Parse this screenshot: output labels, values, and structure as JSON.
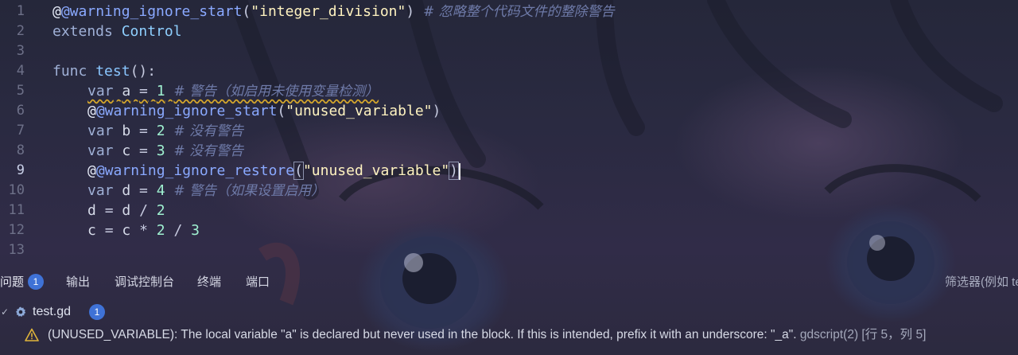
{
  "editor": {
    "active_line": 9,
    "lines": [
      {
        "n": "1",
        "annotation": "@warning_ignore_start",
        "arg": "\"integer_division\"",
        "comment": "# 忽略整个代码文件的整除警告"
      },
      {
        "n": "2",
        "keyword": "extends",
        "class_name": "Control"
      },
      {
        "n": "3"
      },
      {
        "n": "4",
        "keyword": "func",
        "func_name": "test",
        "tail": "():"
      },
      {
        "n": "5",
        "keyword": "var",
        "name": "a",
        "eq": "=",
        "value": "1",
        "comment": "# 警告（如启用未使用变量检测）"
      },
      {
        "n": "6",
        "annotation": "@warning_ignore_start",
        "arg": "\"unused_variable\""
      },
      {
        "n": "7",
        "keyword": "var",
        "name": "b",
        "eq": "=",
        "value": "2",
        "comment": "# 没有警告"
      },
      {
        "n": "8",
        "keyword": "var",
        "name": "c",
        "eq": "=",
        "value": "3",
        "comment": "# 没有警告"
      },
      {
        "n": "9",
        "annotation": "@warning_ignore_restore",
        "arg": "\"unused_variable\""
      },
      {
        "n": "10",
        "keyword": "var",
        "name": "d",
        "eq": "=",
        "value": "4",
        "comment": "# 警告（如果设置启用）"
      },
      {
        "n": "11",
        "expr": "d = d / 2"
      },
      {
        "n": "12",
        "expr": "c = c * 2 / 3"
      },
      {
        "n": "13"
      }
    ]
  },
  "panel": {
    "tabs": [
      {
        "label": "问题",
        "badge": "1"
      },
      {
        "label": "输出"
      },
      {
        "label": "调试控制台"
      },
      {
        "label": "终端"
      },
      {
        "label": "端口"
      }
    ],
    "filter_placeholder": "筛选器(例如 text",
    "file": {
      "name": "test.gd",
      "count": "1",
      "icon": "gdscript-icon"
    },
    "problem": {
      "icon": "warning-icon",
      "message": "(UNUSED_VARIABLE): The local variable \"a\" is declared but never used in the block. If this is intended, prefix it with an underscore: \"_a\".",
      "source": "gdscript(2)",
      "location": "[行 5，列 5]"
    }
  },
  "colors": {
    "background": "#232438",
    "badge": "#3f72d6",
    "warning": "#d4a72c",
    "string": "#fff3c0",
    "number": "#9ff0d0",
    "annotation": "#8aa9ff",
    "comment": "#6e7aa8"
  }
}
